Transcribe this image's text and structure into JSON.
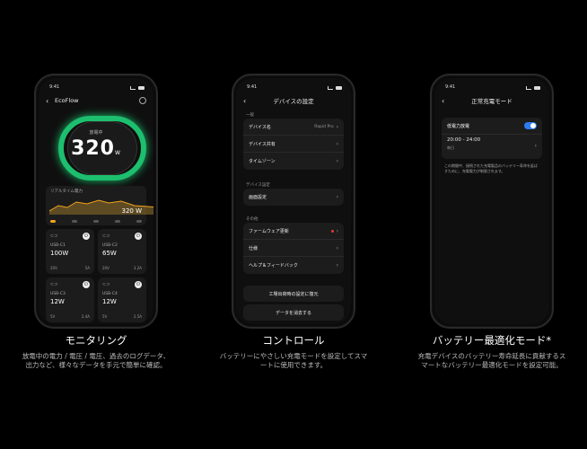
{
  "phone1": {
    "time": "9:41",
    "nav_title": "EcoFlow",
    "gauge_label": "放電中",
    "gauge_value": "320",
    "gauge_unit": "W",
    "realtime_title": "リアルタイム電力",
    "realtime_value": "320 W",
    "ports": [
      {
        "name": "USB-C1",
        "watt": "100W",
        "volt": "20V",
        "amp": "5A"
      },
      {
        "name": "USB-C2",
        "watt": "65W",
        "volt": "20V",
        "amp": "3.2A"
      },
      {
        "name": "USB-C3",
        "watt": "12W",
        "volt": "5V",
        "amp": "2.4A"
      },
      {
        "name": "USB-C4",
        "watt": "12W",
        "volt": "5V",
        "amp": "2.5A"
      }
    ]
  },
  "phone2": {
    "time": "9:41",
    "nav_title": "デバイスの設定",
    "sections": [
      {
        "label": "一般",
        "rows": [
          {
            "label": "デバイス名",
            "value": "Rapid Pro"
          },
          {
            "label": "デバイス共有",
            "value": ""
          },
          {
            "label": "タイムゾーン",
            "value": ""
          }
        ]
      },
      {
        "label": "デバイス設定",
        "rows": [
          {
            "label": "画面設定",
            "value": ""
          }
        ]
      },
      {
        "label": "その他",
        "rows": [
          {
            "label": "ファームウェア更新",
            "value": ""
          },
          {
            "label": "仕様",
            "value": ""
          },
          {
            "label": "ヘルプ＆フィードバック",
            "value": ""
          }
        ]
      }
    ],
    "buttons": [
      "工場出荷時の設定に復元",
      "データを消去する"
    ]
  },
  "phone3": {
    "time": "9:41",
    "nav_title": "正常充電モード",
    "toggle_label": "低電力放電",
    "toggle_on": true,
    "time_range": "20:00 - 24:00",
    "time_repeat": "毎日",
    "description": "この期間中、接続された充電製品のバッテリー寿命を延ばすために、充電電力が制限されます。"
  },
  "captions": [
    {
      "title": "モニタリング",
      "text": "放電中の電力 / 電圧 / 電圧、過去のログデータ、出力など、様々なデータを手元で簡単に確認。"
    },
    {
      "title": "コントロール",
      "text": "バッテリーにやさしい充電モードを設定してスマートに使用できます。"
    },
    {
      "title": "バッテリー最適化モード*",
      "text": "充電デバイスのバッテリー寿命延長に貢献するスマートなバッテリー最適化モードを設定可能。"
    }
  ],
  "colors": {
    "accent_green": "#1dbf6e",
    "accent_blue": "#2d7bf0",
    "accent_orange": "#f3a31b"
  }
}
